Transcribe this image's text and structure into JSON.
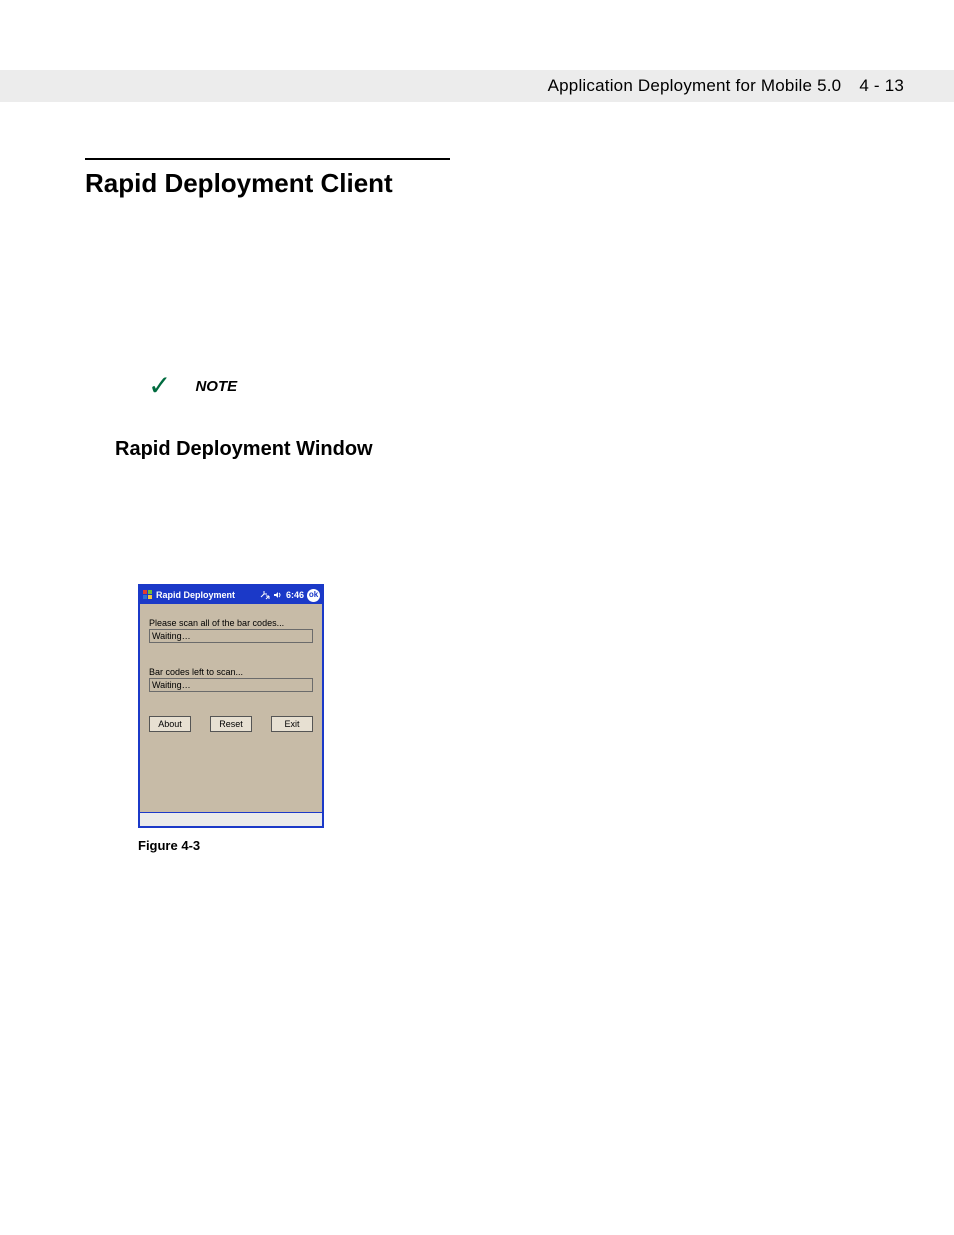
{
  "header": {
    "title": "Application Deployment for Mobile 5.0",
    "page": "4 - 13"
  },
  "section": {
    "h1": "Rapid Deployment Client",
    "note_label": "NOTE",
    "h2": "Rapid Deployment Window"
  },
  "device": {
    "titlebar": {
      "title": "Rapid Deployment",
      "clock": "6:46",
      "ok": "ok"
    },
    "label1": "Please scan all of the bar codes...",
    "value1": "Waiting…",
    "label2": "Bar codes left to scan...",
    "value2": "Waiting…",
    "buttons": {
      "about": "About",
      "reset": "Reset",
      "exit": "Exit"
    }
  },
  "figure": {
    "caption": "Figure 4-3"
  }
}
